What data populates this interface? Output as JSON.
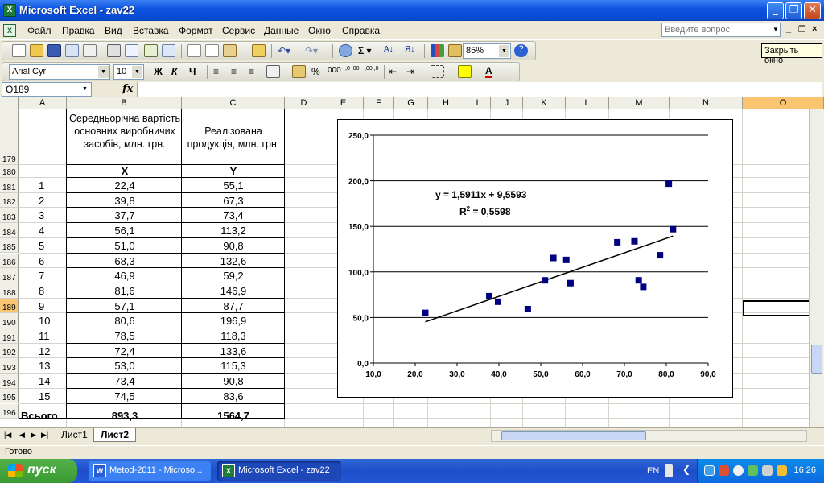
{
  "window": {
    "title": "Microsoft Excel - zav22",
    "app_icon_label": "X"
  },
  "menu": {
    "items": [
      "Файл",
      "Правка",
      "Вид",
      "Вставка",
      "Формат",
      "Сервис",
      "Данные",
      "Окно",
      "Справка"
    ],
    "help_placeholder": "Введите вопрос",
    "doc_minimize": "_",
    "doc_restore": "❐",
    "doc_close": "×"
  },
  "toolbar_standard": {
    "zoom": "85%"
  },
  "toolbar_format": {
    "font": "Arial Cyr",
    "size": "10",
    "bold": "Ж",
    "italic": "К",
    "underline": "Ч",
    "percent": "%",
    "thousands": "000",
    "inc_decimal": ",0 ,00",
    "dec_decimal": ",00 ,0"
  },
  "tooltip": "Закрыть окно",
  "formula_bar": {
    "name_box": "O189",
    "fx": "fx",
    "content": ""
  },
  "columns": [
    "A",
    "B",
    "C",
    "D",
    "E",
    "F",
    "G",
    "H",
    "I",
    "J",
    "K",
    "L",
    "M",
    "N",
    "O"
  ],
  "rows": [
    "179",
    "180",
    "181",
    "182",
    "183",
    "184",
    "185",
    "186",
    "187",
    "188",
    "189",
    "190",
    "191",
    "192",
    "193",
    "194",
    "195",
    "196"
  ],
  "table": {
    "header_b": "Середньорічна вартість основних виробничих засобів, млн. грн.",
    "header_c": "Реалізована продукція, млн. грн.",
    "sub_b": "X",
    "sub_c": "Y",
    "records": [
      {
        "n": "1",
        "x": "22,4",
        "y": "55,1"
      },
      {
        "n": "2",
        "x": "39,8",
        "y": "67,3"
      },
      {
        "n": "3",
        "x": "37,7",
        "y": "73,4"
      },
      {
        "n": "4",
        "x": "56,1",
        "y": "113,2"
      },
      {
        "n": "5",
        "x": "51,0",
        "y": "90,8"
      },
      {
        "n": "6",
        "x": "68,3",
        "y": "132,6"
      },
      {
        "n": "7",
        "x": "46,9",
        "y": "59,2"
      },
      {
        "n": "8",
        "x": "81,6",
        "y": "146,9"
      },
      {
        "n": "9",
        "x": "57,1",
        "y": "87,7"
      },
      {
        "n": "10",
        "x": "80,6",
        "y": "196,9"
      },
      {
        "n": "11",
        "x": "78,5",
        "y": "118,3"
      },
      {
        "n": "12",
        "x": "72,4",
        "y": "133,6"
      },
      {
        "n": "13",
        "x": "53,0",
        "y": "115,3"
      },
      {
        "n": "14",
        "x": "73,4",
        "y": "90,8"
      },
      {
        "n": "15",
        "x": "74,5",
        "y": "83,6"
      }
    ],
    "total_label": "Всього",
    "total_x": "893,3",
    "total_y": "1564,7"
  },
  "chart_data": {
    "type": "scatter",
    "title": "",
    "xlabel": "",
    "ylabel": "",
    "xlim": [
      10,
      90
    ],
    "ylim": [
      0,
      250
    ],
    "xticks": [
      "10,0",
      "20,0",
      "30,0",
      "40,0",
      "50,0",
      "60,0",
      "70,0",
      "80,0",
      "90,0"
    ],
    "yticks": [
      "0,0",
      "50,0",
      "100,0",
      "150,0",
      "200,0",
      "250,0"
    ],
    "grid": "horizontal",
    "marker_color": "#000080",
    "points": [
      {
        "x": 22.4,
        "y": 55.1
      },
      {
        "x": 39.8,
        "y": 67.3
      },
      {
        "x": 37.7,
        "y": 73.4
      },
      {
        "x": 56.1,
        "y": 113.2
      },
      {
        "x": 51.0,
        "y": 90.8
      },
      {
        "x": 68.3,
        "y": 132.6
      },
      {
        "x": 46.9,
        "y": 59.2
      },
      {
        "x": 81.6,
        "y": 146.9
      },
      {
        "x": 57.1,
        "y": 87.7
      },
      {
        "x": 80.6,
        "y": 196.9
      },
      {
        "x": 78.5,
        "y": 118.3
      },
      {
        "x": 72.4,
        "y": 133.6
      },
      {
        "x": 53.0,
        "y": 115.3
      },
      {
        "x": 73.4,
        "y": 90.8
      },
      {
        "x": 74.5,
        "y": 83.6
      }
    ],
    "trendline": {
      "slope": 1.5911,
      "intercept": 9.5593,
      "x_from": 22.4,
      "x_to": 81.6
    },
    "equation": "y = 1,5911x + 9,5593",
    "r2_label": "R",
    "r2_exp": "2",
    "r2_value": " = 0,5598"
  },
  "sheets": {
    "tabs": [
      "Лист1",
      "Лист2"
    ],
    "active": "Лист2"
  },
  "status": "Готово",
  "taskbar": {
    "start": "пуск",
    "tasks": [
      "Metod-2011 - Microso...",
      "Microsoft Excel - zav22"
    ],
    "lang": "EN",
    "clock": "16:26"
  }
}
